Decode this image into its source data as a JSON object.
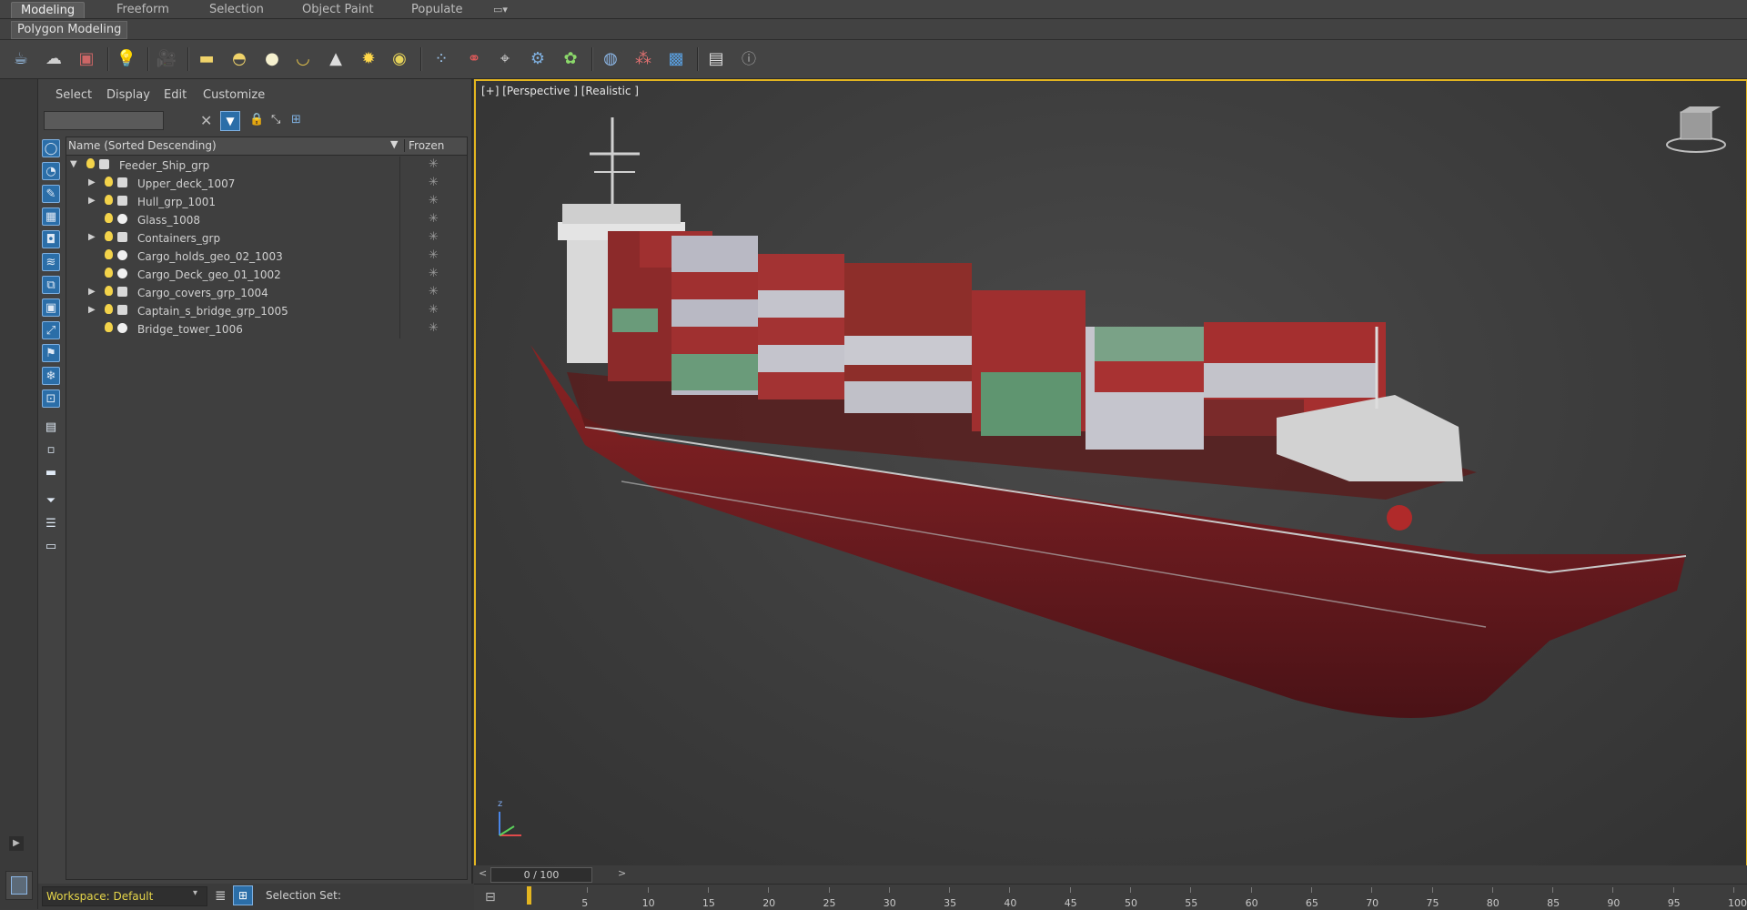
{
  "ribbon": {
    "tabs": [
      "Modeling",
      "Freeform",
      "Selection",
      "Object Paint",
      "Populate"
    ],
    "active_tab": "Modeling",
    "subpanel": "Polygon Modeling"
  },
  "explorer": {
    "menu": [
      "Select",
      "Display",
      "Edit",
      "Customize"
    ],
    "header_name": "Name (Sorted Descending)",
    "header_frozen": "Frozen",
    "rows": [
      {
        "name": "Feeder_Ship_grp",
        "level": 0,
        "expanded": true,
        "type": "group"
      },
      {
        "name": "Upper_deck_1007",
        "level": 1,
        "expanded": false,
        "type": "group"
      },
      {
        "name": "Hull_grp_1001",
        "level": 1,
        "expanded": false,
        "type": "group"
      },
      {
        "name": "Glass_1008",
        "level": 1,
        "expanded": null,
        "type": "mesh"
      },
      {
        "name": "Containers_grp",
        "level": 1,
        "expanded": false,
        "type": "group"
      },
      {
        "name": "Cargo_holds_geo_02_1003",
        "level": 1,
        "expanded": null,
        "type": "mesh"
      },
      {
        "name": "Cargo_Deck_geo_01_1002",
        "level": 1,
        "expanded": null,
        "type": "mesh"
      },
      {
        "name": "Cargo_covers_grp_1004",
        "level": 1,
        "expanded": false,
        "type": "group"
      },
      {
        "name": "Captain_s_bridge_grp_1005",
        "level": 1,
        "expanded": false,
        "type": "group"
      },
      {
        "name": "Bridge_tower_1006",
        "level": 1,
        "expanded": null,
        "type": "mesh"
      }
    ],
    "workspace": "Workspace: Default",
    "selection_set": "Selection Set:"
  },
  "viewport": {
    "label": "[+] [Perspective ] [Realistic ]",
    "axis_label": "z"
  },
  "timeline": {
    "frame": "0 / 100",
    "ticks": [
      "5",
      "10",
      "15",
      "20",
      "25",
      "30",
      "35",
      "40",
      "45",
      "50",
      "55",
      "60",
      "65",
      "70",
      "75",
      "80",
      "85",
      "90",
      "95",
      "100"
    ]
  },
  "colors": {
    "accent_border": "#e3b520",
    "hull_red": "#7a1d1d",
    "workspace_text": "#e6d64a"
  }
}
